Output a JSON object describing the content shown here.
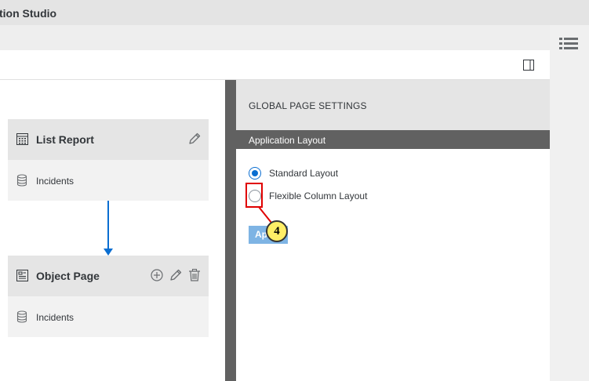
{
  "window": {
    "title": "tion Studio"
  },
  "toolbar": {
    "panel_toggle_icon": "panel-toggle-icon"
  },
  "right_strip": {
    "list_icon": "list-icon"
  },
  "canvas": {
    "nodes": [
      {
        "title": "List Report",
        "icon": "list-report-icon",
        "entity": "Incidents",
        "entity_icon": "database-icon",
        "actions": [
          "edit"
        ]
      },
      {
        "title": "Object Page",
        "icon": "object-page-icon",
        "entity": "Incidents",
        "entity_icon": "database-icon",
        "actions": [
          "add",
          "edit",
          "delete"
        ]
      }
    ]
  },
  "panel": {
    "title": "GLOBAL PAGE SETTINGS",
    "section": "Application Layout",
    "options": [
      {
        "label": "Standard Layout",
        "selected": true
      },
      {
        "label": "Flexible Column Layout",
        "selected": false
      }
    ],
    "apply_label": "Ap"
  },
  "annotation": {
    "step": "4"
  },
  "colors": {
    "accent": "#0a6ed1",
    "divider": "#616161",
    "apply_bg": "#7eb4e4",
    "highlight": "#e00000",
    "badge": "#ffee66"
  }
}
